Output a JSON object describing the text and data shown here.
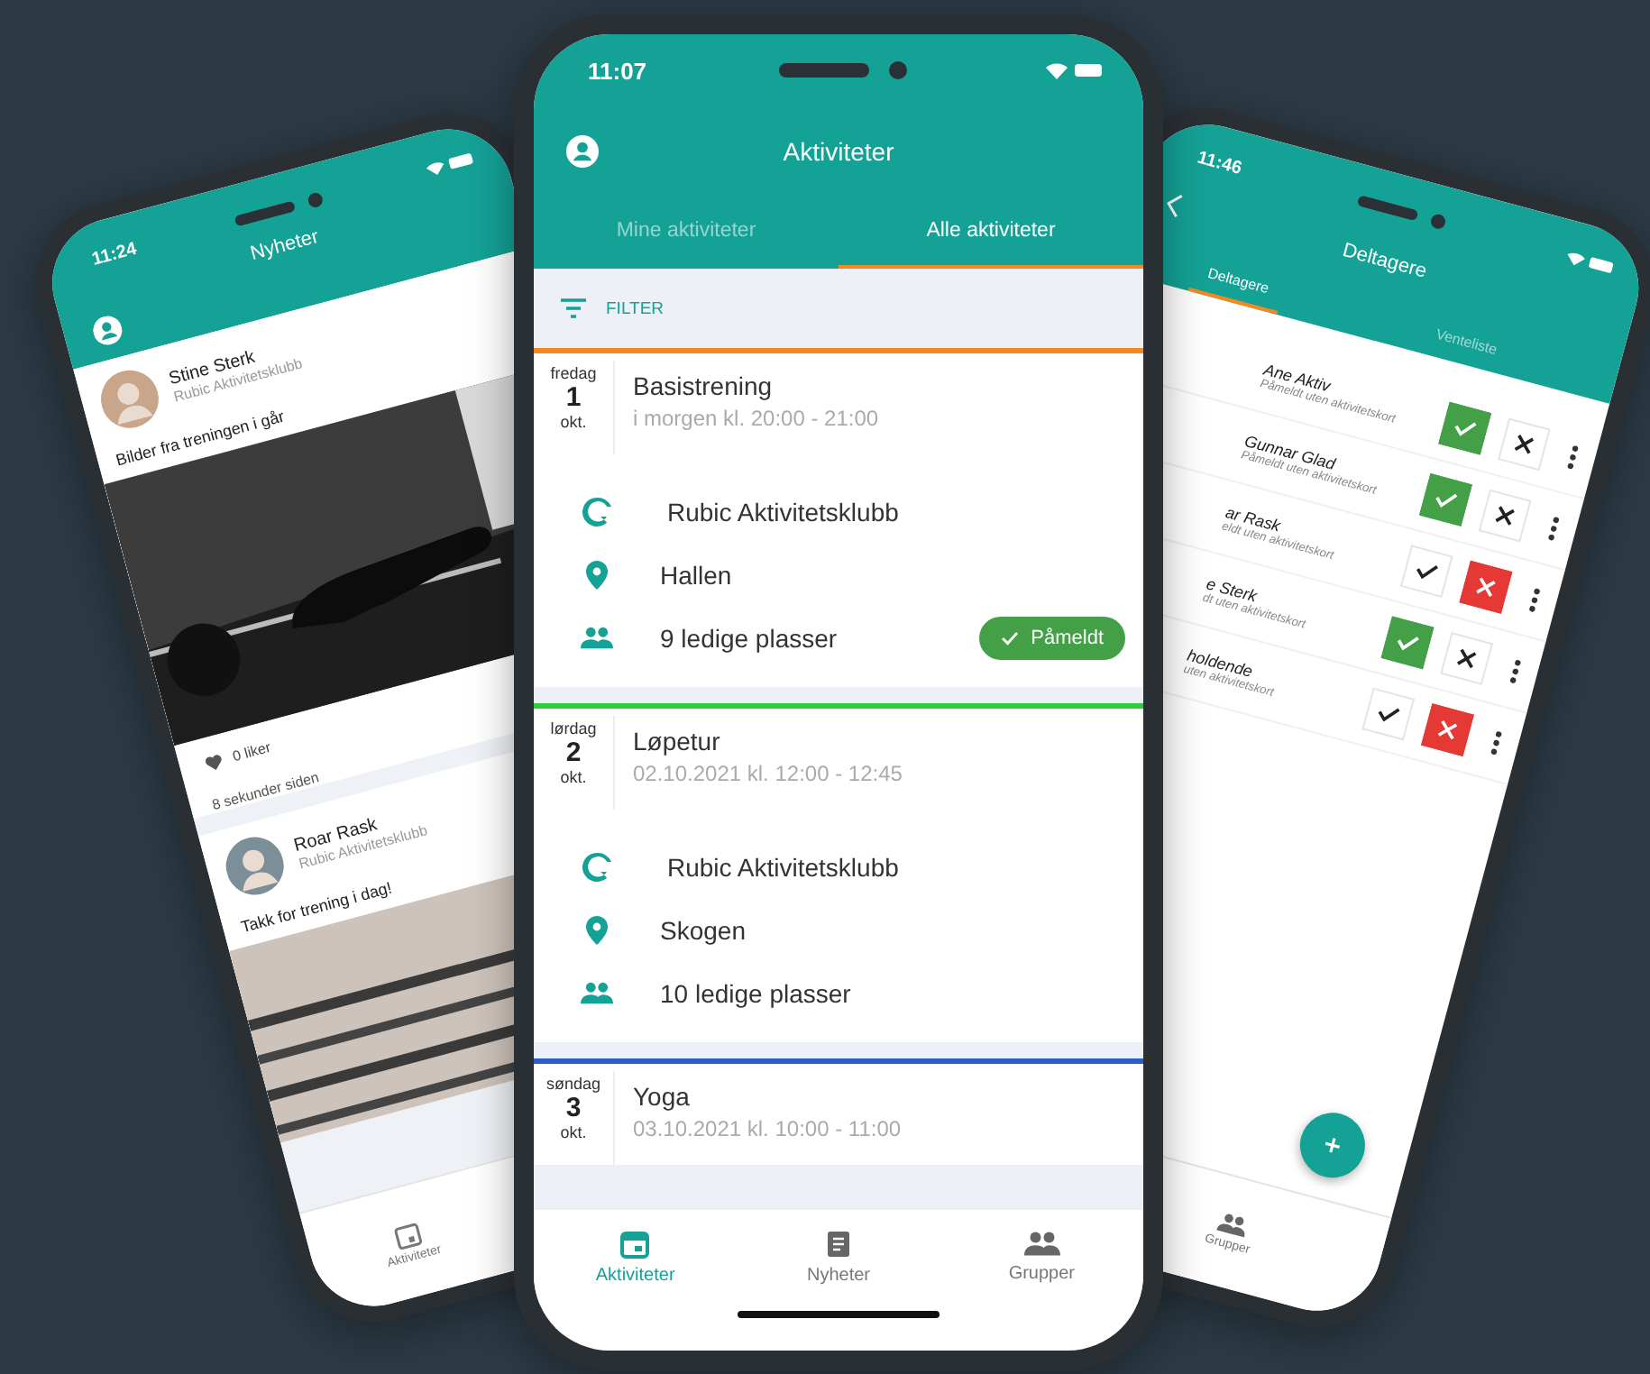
{
  "left_phone": {
    "status_time": "11:24",
    "title": "Nyheter",
    "posts": [
      {
        "author": "Stine Sterk",
        "club": "Rubic Aktivitetsklubb",
        "text": "Bilder fra treningen i går",
        "likes": "0 liker",
        "time": "8 sekunder siden"
      },
      {
        "author": "Roar Rask",
        "club": "Rubic Aktivitetsklubb",
        "text": "Takk for trening i dag!"
      }
    ],
    "nav": [
      {
        "label": "Aktiviteter",
        "selected": false
      }
    ]
  },
  "center_phone": {
    "status_time": "11:07",
    "title": "Aktiviteter",
    "tabs": [
      {
        "label": "Mine aktiviteter",
        "selected": false
      },
      {
        "label": "Alle aktiviteter",
        "selected": true
      }
    ],
    "filter": "FILTER",
    "events": [
      {
        "color": "#f5891f",
        "weekday": "fredag",
        "day": "1",
        "month": "okt.",
        "title": "Basistrening",
        "time": "i morgen kl. 20:00 - 21:00",
        "club": "Rubic Aktivitetsklubb",
        "place": "Hallen",
        "spots": "9 ledige plasser",
        "button": "Påmeldt"
      },
      {
        "color": "#2fcc3c",
        "weekday": "lørdag",
        "day": "2",
        "month": "okt.",
        "title": "Løpetur",
        "time": "02.10.2021 kl. 12:00 - 12:45",
        "club": "Rubic Aktivitetsklubb",
        "place": "Skogen",
        "spots": "10 ledige plasser"
      },
      {
        "color": "#2a5fc8",
        "weekday": "søndag",
        "day": "3",
        "month": "okt.",
        "title": "Yoga",
        "time": "03.10.2021 kl. 10:00 - 11:00"
      }
    ],
    "nav": [
      {
        "label": "Aktiviteter",
        "kind": "calendar",
        "selected": true
      },
      {
        "label": "Nyheter",
        "kind": "news",
        "selected": false
      },
      {
        "label": "Grupper",
        "kind": "groups",
        "selected": false
      }
    ]
  },
  "right_phone": {
    "status_time": "11:46",
    "title": "Deltagere",
    "tabs": [
      {
        "label": "Deltagere",
        "selected": true
      },
      {
        "label": "Venteliste",
        "selected": false
      }
    ],
    "participants": [
      {
        "name": "Ane Aktiv",
        "note": "Påmeldt uten aktivitetskort",
        "present": true
      },
      {
        "name": "Gunnar Glad",
        "note": "Påmeldt uten aktivitetskort",
        "present": true
      },
      {
        "name": "ar Rask",
        "note": "eldt uten aktivitetskort",
        "present": false
      },
      {
        "name": "e Sterk",
        "note": "dt uten aktivitetskort",
        "present": true
      },
      {
        "name": "holdende",
        "note": "uten aktivitetskort",
        "present": false
      }
    ],
    "nav": [
      {
        "label": "Grupper",
        "selected": false
      }
    ]
  }
}
